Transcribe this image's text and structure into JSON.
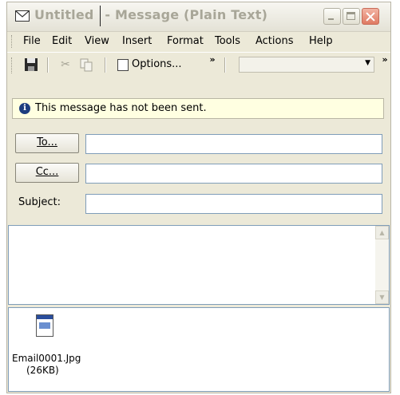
{
  "window": {
    "title_doc": "Untitled",
    "title_rest": "- Message (Plain Text)"
  },
  "menu": {
    "items": [
      {
        "name": "file",
        "label": "File"
      },
      {
        "name": "edit",
        "label": "Edit"
      },
      {
        "name": "view",
        "label": "View"
      },
      {
        "name": "insert",
        "label": "Insert"
      },
      {
        "name": "format",
        "label": "Format"
      },
      {
        "name": "tools",
        "label": "Tools"
      },
      {
        "name": "actions",
        "label": "Actions"
      },
      {
        "name": "help",
        "label": "Help"
      }
    ]
  },
  "toolbar": {
    "options_label": "Options...",
    "more_label": "»"
  },
  "info": {
    "text": "This message has not been sent."
  },
  "fields": {
    "to_label": "To...",
    "cc_label": "Cc...",
    "subject_label": "Subject:",
    "to_value": "",
    "cc_value": "",
    "subject_value": ""
  },
  "attachment": {
    "name": "Email0001.Jpg",
    "size": "(26KB)"
  }
}
